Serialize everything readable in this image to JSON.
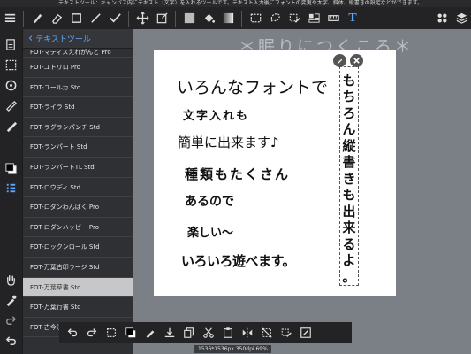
{
  "status_text": "テキストツール：キャンバス内にテキスト（文字）を入れるツールです。テキスト入力後にフォントの変更や太字、斜体、縦書きの設定などができます。",
  "panel": {
    "title": "テキストツール",
    "fonts": [
      "FOT-マティスえれがんと Pro",
      "FOT-ユトリロ Pro",
      "FOT-ユールカ Std",
      "FOT-ライラ Std",
      "FOT-ラグランパンチ Std",
      "FOT-ランパート Std",
      "FOT-ランパートTL Std",
      "FOT-ロウディ Std",
      "FOT-ロダンわんぱく Pro",
      "FOT-ロダンハッピー Pro",
      "FOT-ロックンロール Std",
      "FOT-万葉古印ラージ Std",
      "FOT-万葉草書 Std",
      "FOT-万葉行書 Std",
      "FOT-古今江"
    ],
    "selected_index": 12
  },
  "canvas": {
    "title": "＊眠りにつくころ＊",
    "lines": [
      "いろんなフォントで",
      "文字入れも",
      "簡単に出来ます♪",
      "種類もたくさん",
      "あるので",
      "楽しい～",
      "いろいろ遊べます。"
    ],
    "vertical_text": "もちろん縦書きも出来るよ。",
    "info": "1536*1536px 350dpi 69%"
  },
  "colors": {
    "accent": "#5aa8ff",
    "background": "#7b7f86",
    "panel": "#2f3033",
    "toolbar": "#232325"
  }
}
